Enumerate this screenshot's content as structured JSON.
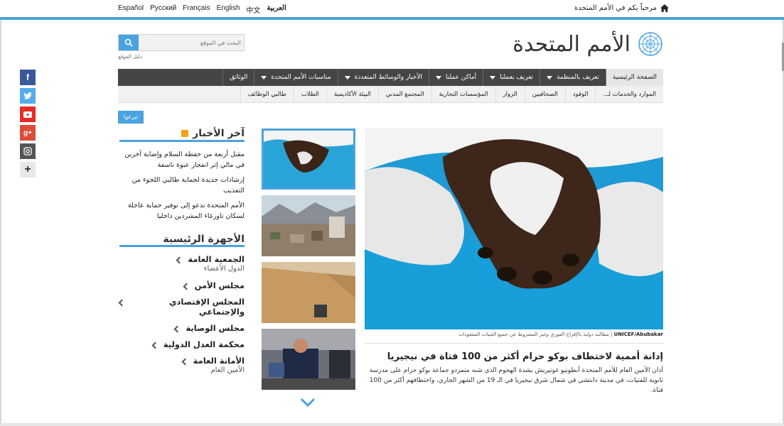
{
  "languages": [
    "Español",
    "Русский",
    "Français",
    "English",
    "中文",
    "العربية"
  ],
  "welcome_text": "مرحباً بكم في الأمم المتحدة",
  "logo_text": "الأمم المتحدة",
  "search": {
    "placeholder": "البحث في الموقع",
    "sitemap_label": "دليل الموقع"
  },
  "mainnav": [
    {
      "label": "الصفحة الرئيسية",
      "dropdown": false
    },
    {
      "label": "تعريف بالمنظمة",
      "dropdown": true
    },
    {
      "label": "تعريف بعملنا",
      "dropdown": true
    },
    {
      "label": "أماكن عملنا",
      "dropdown": true
    },
    {
      "label": "الأخبار والوسائط المتعددة",
      "dropdown": true
    },
    {
      "label": "مناسبات الأمم المتحدة",
      "dropdown": true
    },
    {
      "label": "الوثائق",
      "dropdown": false
    }
  ],
  "subnav": [
    "الموارد والخدمات لـ..",
    "الوفود",
    "الصحافيين",
    "الزوار",
    "المؤسسات التجارية",
    "المجتمع المدني",
    "البيئة الأكاديمية",
    "الطلاب",
    "طالبي الوظائف"
  ],
  "donate_label": "تبرعوا",
  "news": {
    "title": "آخر الأخبار",
    "items": [
      "مقتل أربعة من حفظة السلام وإصابة آخرين في مالي إثر انفجار عبوة ناسفة",
      "إرشادات جديدة لحماية طالبي اللجوء من التعذيب",
      "الأمم المتحدة تدعو إلى توفير حماية عاجلة لسكان تاورغاء المشردين داخليا"
    ]
  },
  "organs": {
    "title": "الأجهزة الرئيسية",
    "items": [
      {
        "title": "الجمعية العامة",
        "sub": "الدول الأعضاء"
      },
      {
        "title": "مجلس الأمن",
        "sub": ""
      },
      {
        "title": "المجلس الإقتصادي والإجتماعي",
        "sub": ""
      },
      {
        "title": "مجلس الوصاية",
        "sub": ""
      },
      {
        "title": "محكمة العدل الدولية",
        "sub": ""
      },
      {
        "title": "الأمانة العامة",
        "sub": "الأمين العام"
      }
    ]
  },
  "feature": {
    "credit": "UNICEF/Abubakar",
    "caption": "مطالبة دولية بالإفراج الفوري وغير المشروط عن جميع الفتيات المفقودات",
    "title": "إدانة أممية لاختطاف بوكو حرام أكثر من 100 فتاة في نيجيريا",
    "body": "أدان الأمين العام للأمم المتحدة أنطونيو غوتيريش بشدة الهجوم الذي شنه متمردو جماعة بوكو حرام على مدرسة ثانوية للفتيات، في مدينة دابتشي في شمال شرق نيجيريا في الـ 19 من الشهر الجاري، واختطافهم أكثر من 100 فتاة."
  },
  "social_icons": [
    "facebook-icon",
    "twitter-icon",
    "youtube-icon",
    "googleplus-icon",
    "instagram-icon",
    "more-icon"
  ],
  "colors": {
    "accent": "#4aa3df",
    "nav_bg": "#454545",
    "subnav_bg": "#f1f1f1",
    "rss": "#f7a21b"
  }
}
